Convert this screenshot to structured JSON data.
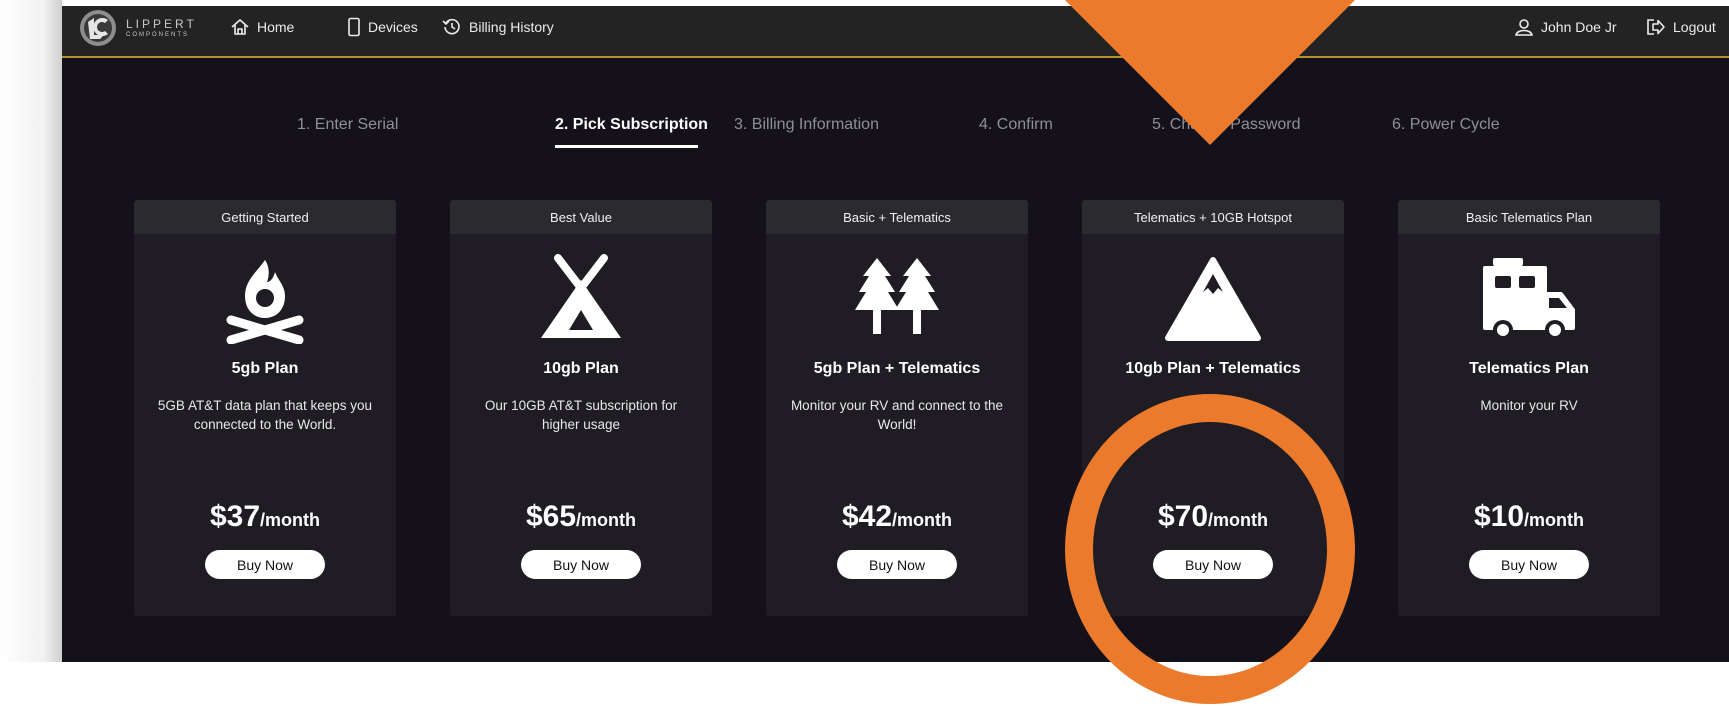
{
  "brand": {
    "name": "LIPPERT",
    "sub": "COMPONENTS"
  },
  "nav": {
    "home": "Home",
    "devices": "Devices",
    "billing_history": "Billing History",
    "user": "John Doe Jr",
    "logout": "Logout"
  },
  "steps": [
    {
      "label": "1. Enter Serial"
    },
    {
      "label": "2. Pick Subscription",
      "active": true
    },
    {
      "label": "3. Billing Information"
    },
    {
      "label": "4. Confirm"
    },
    {
      "label": "5. Change Password"
    },
    {
      "label": "6. Power Cycle"
    }
  ],
  "plans": [
    {
      "header": "Getting Started",
      "icon": "campfire-icon",
      "title": "5gb Plan",
      "description": "5GB AT&T data plan that keeps you connected to the World.",
      "price": "$37",
      "period": "/month",
      "button": "Buy Now"
    },
    {
      "header": "Best Value",
      "icon": "tent-icon",
      "title": "10gb Plan",
      "description": "Our 10GB AT&T subscription for higher usage",
      "price": "$65",
      "period": "/month",
      "button": "Buy Now"
    },
    {
      "header": "Basic + Telematics",
      "icon": "trees-icon",
      "title": "5gb Plan + Telematics",
      "description": "Monitor your RV and connect to the World!",
      "price": "$42",
      "period": "/month",
      "button": "Buy Now"
    },
    {
      "header": "Telematics + 10GB Hotspot",
      "icon": "mountain-icon",
      "title": "10gb Plan + Telematics",
      "description": "",
      "price": "$70",
      "period": "/month",
      "button": "Buy Now"
    },
    {
      "header": "Basic Telematics Plan",
      "icon": "rv-icon",
      "title": "Telematics Plan",
      "description": "Monitor your RV",
      "price": "$10",
      "period": "/month",
      "button": "Buy Now"
    }
  ],
  "colors": {
    "background": "#14111a",
    "topbar": "#232323",
    "accent_line": "#b8902f",
    "card": "#1f1d23",
    "card_header": "#2b2a2f",
    "annotation": "#ec7a2c"
  }
}
